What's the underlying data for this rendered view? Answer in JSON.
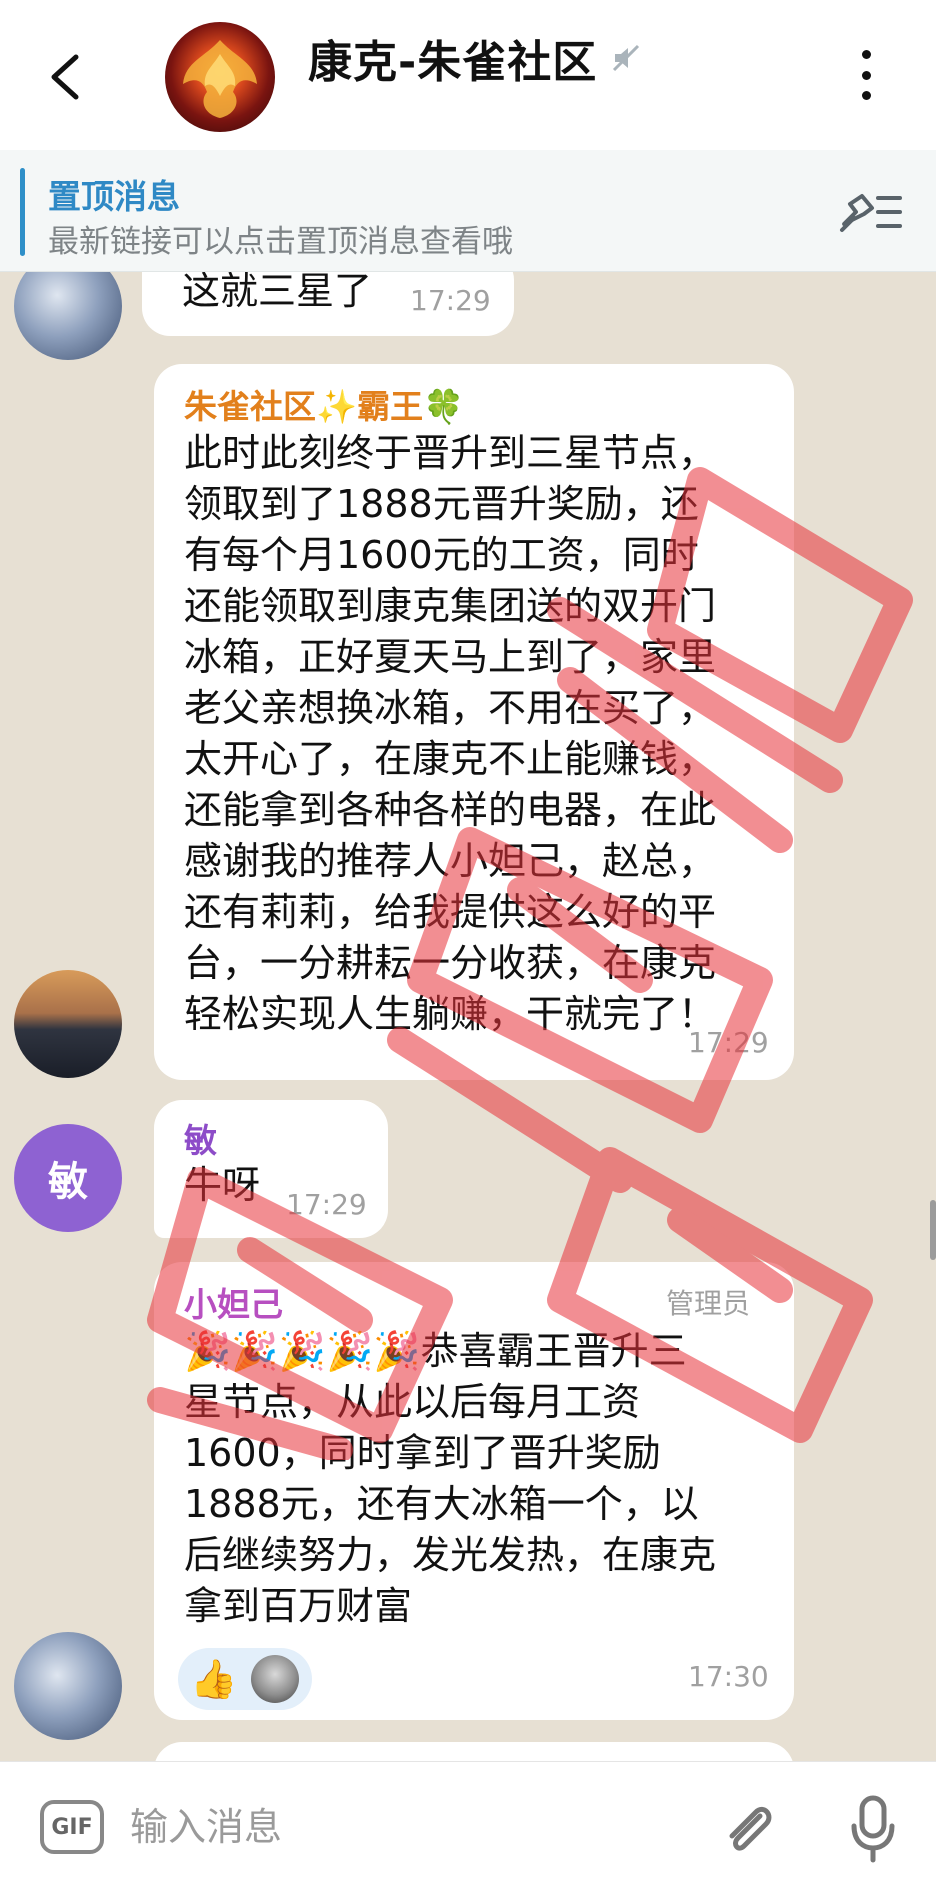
{
  "header": {
    "title": "康克-朱雀社区"
  },
  "pinned": {
    "title": "置顶消息",
    "text": "最新链接可以点击置顶消息查看哦"
  },
  "messages": [
    {
      "text": "这就三星了",
      "time": "17:29"
    },
    {
      "sender": "朱雀社区✨霸王🍀",
      "lines": [
        "此时此刻终于晋升到三星节点，",
        "领取到了1888元晋升奖励，还",
        "有每个月1600元的工资，同时",
        "还能领取到康克集团送的双开门",
        "冰箱，正好夏天马上到了，家里",
        "老父亲想换冰箱，不用在买了，",
        "太开心了，在康克不止能赚钱，",
        "还能拿到各种各样的电器，在此",
        "感谢我的推荐人小妲己，赵总，",
        "还有莉莉，给我提供这么好的平",
        "台，一分耕耘一分收获，在康克",
        "轻松实现人生躺赚，干就完了！"
      ],
      "time": "17:29"
    },
    {
      "avatar_letter": "敏",
      "sender": "敏",
      "text": "牛呀",
      "time": "17:29"
    },
    {
      "sender": "小妲己",
      "role": "管理员",
      "lines": [
        "🎉🎉🎉🎉🎉恭喜霸王晋升三",
        "星节点，从此以后每月工资",
        "1600，同时拿到了晋升奖励",
        "1888元，还有大冰箱一个，以",
        "后继续努力，发光发热，在康克",
        "拿到百万财富"
      ],
      "reaction": "👍",
      "time": "17:30"
    }
  ],
  "input": {
    "gif_label": "GIF",
    "placeholder": "输入消息"
  },
  "colors": {
    "pinned_accent": "#2f89c5",
    "sender_orange": "#e2801c",
    "sender_purple": "#8d4cc8",
    "watermark": "#e8323a"
  }
}
